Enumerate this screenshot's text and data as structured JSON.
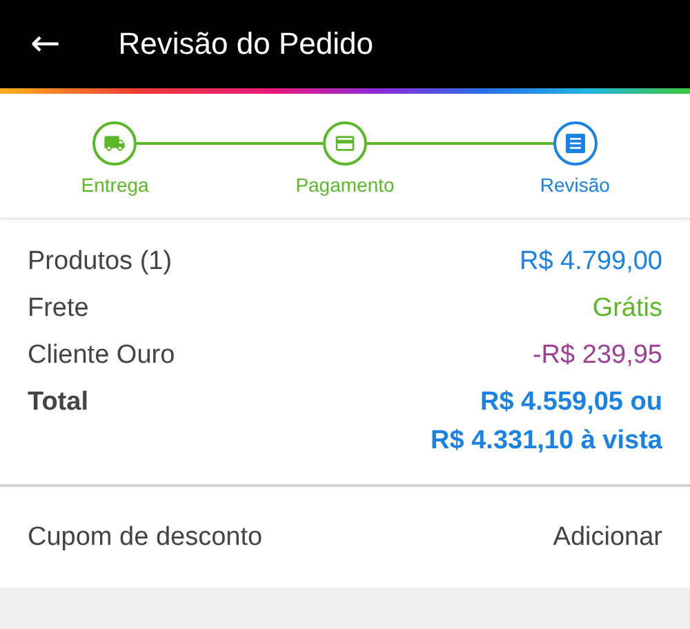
{
  "header": {
    "back": "←",
    "title": "Revisão do Pedido"
  },
  "steps": [
    {
      "label": "Entrega",
      "kind": "truck",
      "selected": false
    },
    {
      "label": "Pagamento",
      "kind": "card",
      "selected": false
    },
    {
      "label": "Revisão",
      "kind": "list",
      "selected": true
    }
  ],
  "summary": [
    {
      "label": "Produtos (1)",
      "values": [
        "R$ 4.799,00"
      ],
      "color": "#1a82e2",
      "kind": "line"
    },
    {
      "label": "Frete",
      "values": [
        "Grátis"
      ],
      "color": "#5cb82a",
      "kind": "line"
    },
    {
      "label": "Cliente Ouro",
      "values": [
        "-R$ 239,95"
      ],
      "color": "#9c3f95",
      "kind": "line"
    },
    {
      "label": "Total",
      "values": [
        "R$ 4.559,05 ou",
        "R$ 4.331,10 à vista"
      ],
      "color": "#1a82e2",
      "kind": "total"
    }
  ],
  "coupon": {
    "label": "Cupom de desconto",
    "action": "Adicionar"
  }
}
